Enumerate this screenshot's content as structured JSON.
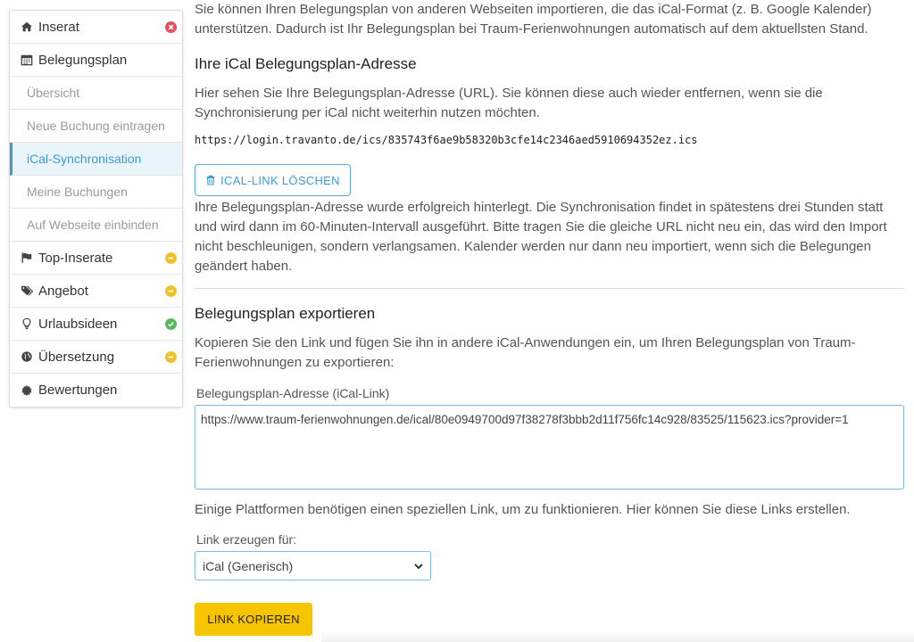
{
  "sidebar": {
    "items": [
      {
        "label": "Inserat",
        "icon": "home-icon",
        "status": "error"
      },
      {
        "label": "Belegungsplan",
        "icon": "calendar-icon"
      },
      {
        "label": "Übersicht"
      },
      {
        "label": "Neue Buchung eintragen"
      },
      {
        "label": "iCal-Synchronisation",
        "active": true
      },
      {
        "label": "Meine Buchungen"
      },
      {
        "label": "Auf Webseite einbinden"
      },
      {
        "label": "Top-Inserate",
        "icon": "flag-icon",
        "status": "warning"
      },
      {
        "label": "Angebot",
        "icon": "tags-icon",
        "status": "warning"
      },
      {
        "label": "Urlaubsideen",
        "icon": "lightbulb-icon",
        "status": "ok"
      },
      {
        "label": "Übersetzung",
        "icon": "globe-icon",
        "status": "warning"
      },
      {
        "label": "Bewertungen",
        "icon": "certificate-icon"
      }
    ]
  },
  "colors": {
    "accent": "#3d9bd4",
    "error": "#e0505e",
    "warning": "#f2c12e",
    "ok": "#5cb85c",
    "button_yellow": "#f7c400"
  },
  "import": {
    "intro": "Sie können Ihren Belegungsplan von anderen Webseiten importieren, die das iCal-Format (z. B. Google Kalender) unterstützen. Dadurch ist Ihr Belegungsplan bei Traum-Ferienwohnungen automatisch auf dem aktuellsten Stand.",
    "heading": "Ihre iCal Belegungsplan-Adresse",
    "description": "Hier sehen Sie Ihre Belegungsplan-Adresse (URL). Sie können diese auch wieder entfernen, wenn sie die Synchronisierung per iCal nicht weiterhin nutzen möchten.",
    "url": "https://login.travanto.de/ics/835743f6ae9b58320b3cfe14c2346aed5910694352ez.ics",
    "delete_button": "ICAL-LINK LÖSCHEN",
    "success_text": "Ihre Belegungsplan-Adresse wurde erfolgreich hinterlegt. Die Synchronisation findet in spätestens drei Stunden statt und wird dann im 60-Minuten-Intervall ausgeführt. Bitte tragen Sie die gleiche URL nicht neu ein, das wird den Import nicht beschleunigen, sondern verlangsamen. Kalender werden nur dann neu importiert, wenn sich die Belegungen geändert haben."
  },
  "export": {
    "heading": "Belegungsplan exportieren",
    "description": "Kopieren Sie den Link und fügen Sie ihn in andere iCal-Anwendungen ein, um Ihren Belegungsplan von Traum-Ferienwohnungen zu exportieren:",
    "address_label": "Belegungsplan-Adresse (iCal-Link)",
    "address_value": "https://www.traum-ferienwohnungen.de/ical/80e0949700d97f38278f3bbb2d11f756fc14c928/83525/115623.ics?provider=1",
    "platform_text": "Einige Plattformen benötigen einen speziellen Link, um zu funktionieren. Hier können Sie diese Links erstellen.",
    "link_for_label": "Link erzeugen für:",
    "link_for_selected": "iCal (Generisch)",
    "copy_button": "LINK KOPIEREN"
  }
}
